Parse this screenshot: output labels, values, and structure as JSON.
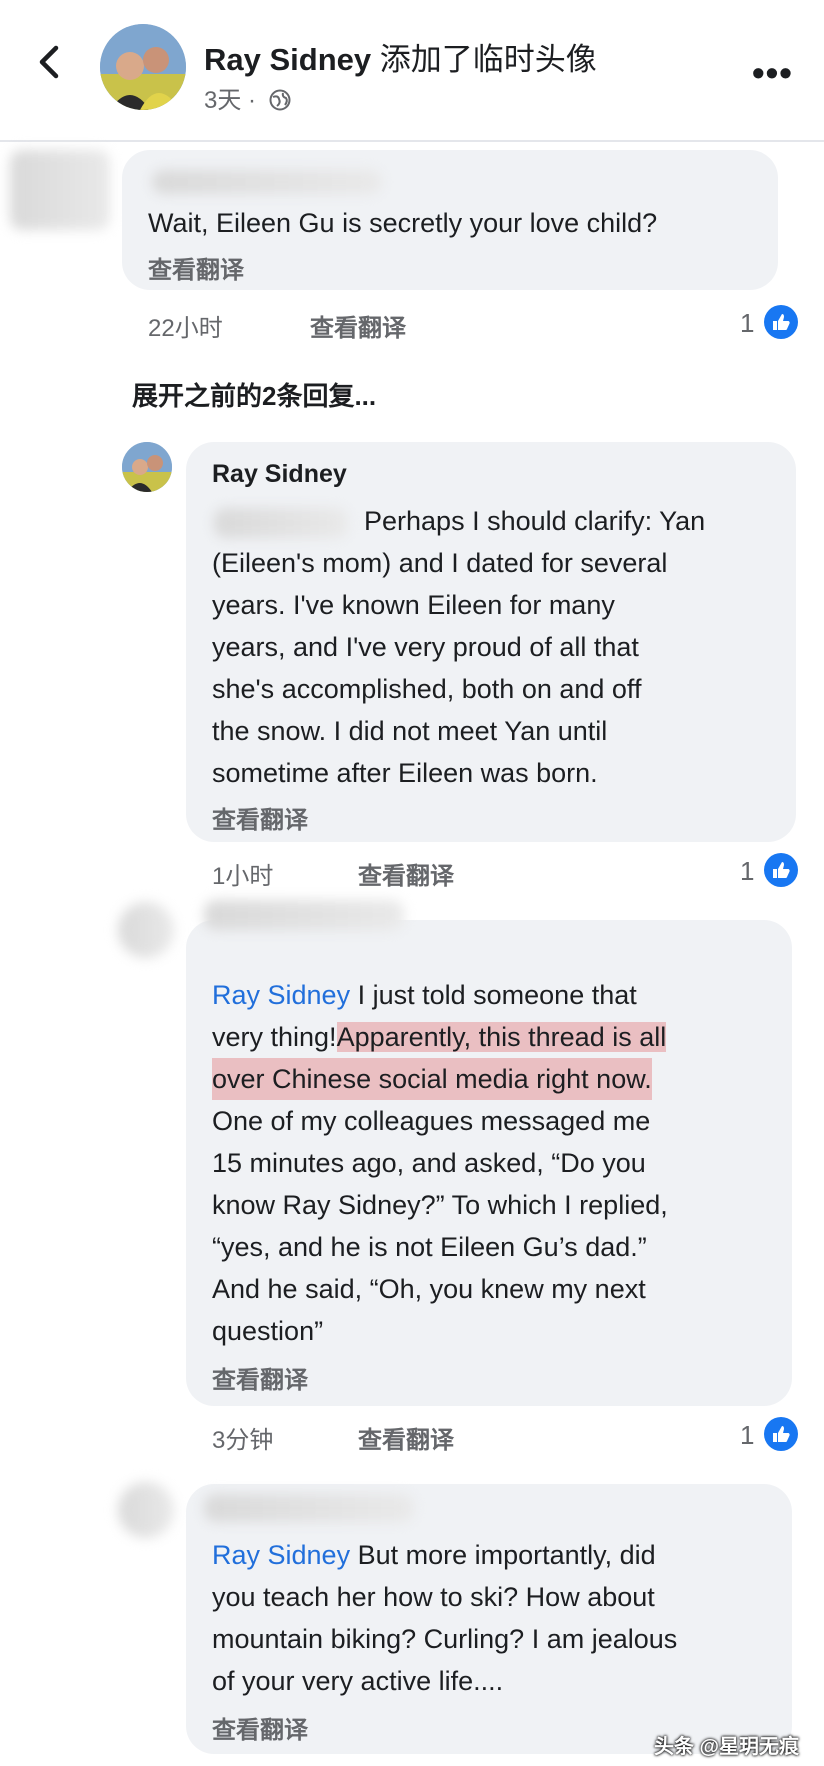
{
  "header": {
    "name": "Ray Sidney",
    "action": "添加了临时头像",
    "time": "3天",
    "dot": "·"
  },
  "comment1": {
    "text": "Wait, Eileen Gu is secretly your love child?",
    "translate": "查看翻译",
    "time": "22小时",
    "translate_action": "查看翻译",
    "likes": "1"
  },
  "expand": "展开之前的2条回复...",
  "reply1": {
    "author": "Ray Sidney",
    "lines": [
      "Perhaps I should clarify: Yan",
      "(Eileen's mom) and I dated for several",
      "years. I've known Eileen for many",
      "years, and I've very proud of all that",
      "she's accomplished, both on and off",
      "the snow. I did not meet Yan until",
      "sometime after Eileen was born."
    ],
    "translate": "查看翻译",
    "time": "1小时",
    "translate_action": "查看翻译",
    "likes": "1"
  },
  "reply2": {
    "mention": "Ray Sidney",
    "l1": " I just told someone that",
    "l2a": "very thing!",
    "l2b": "Apparently, this thread is all",
    "l3": "over Chinese social media right now.",
    "lines": [
      "One of my colleagues messaged me",
      "15 minutes ago, and asked, “Do you",
      "know Ray Sidney?” To which I replied,",
      "“yes, and he is not Eileen Gu’s dad.”",
      "And he said, “Oh, you knew my next",
      "question”"
    ],
    "translate": "查看翻译",
    "time": "3分钟",
    "translate_action": "查看翻译",
    "likes": "1"
  },
  "reply3": {
    "mention": "Ray Sidney",
    "l1": " But more importantly, did",
    "lines": [
      "you teach her how to ski? How about",
      "mountain biking? Curling? I am jealous",
      "of your very active life...."
    ],
    "translate": "查看翻译"
  },
  "watermark": "头条 @星玥无痕",
  "colors": {
    "like_blue": "#1877f2",
    "mention_blue": "#216fdb",
    "bubble": "#f0f2f5"
  }
}
